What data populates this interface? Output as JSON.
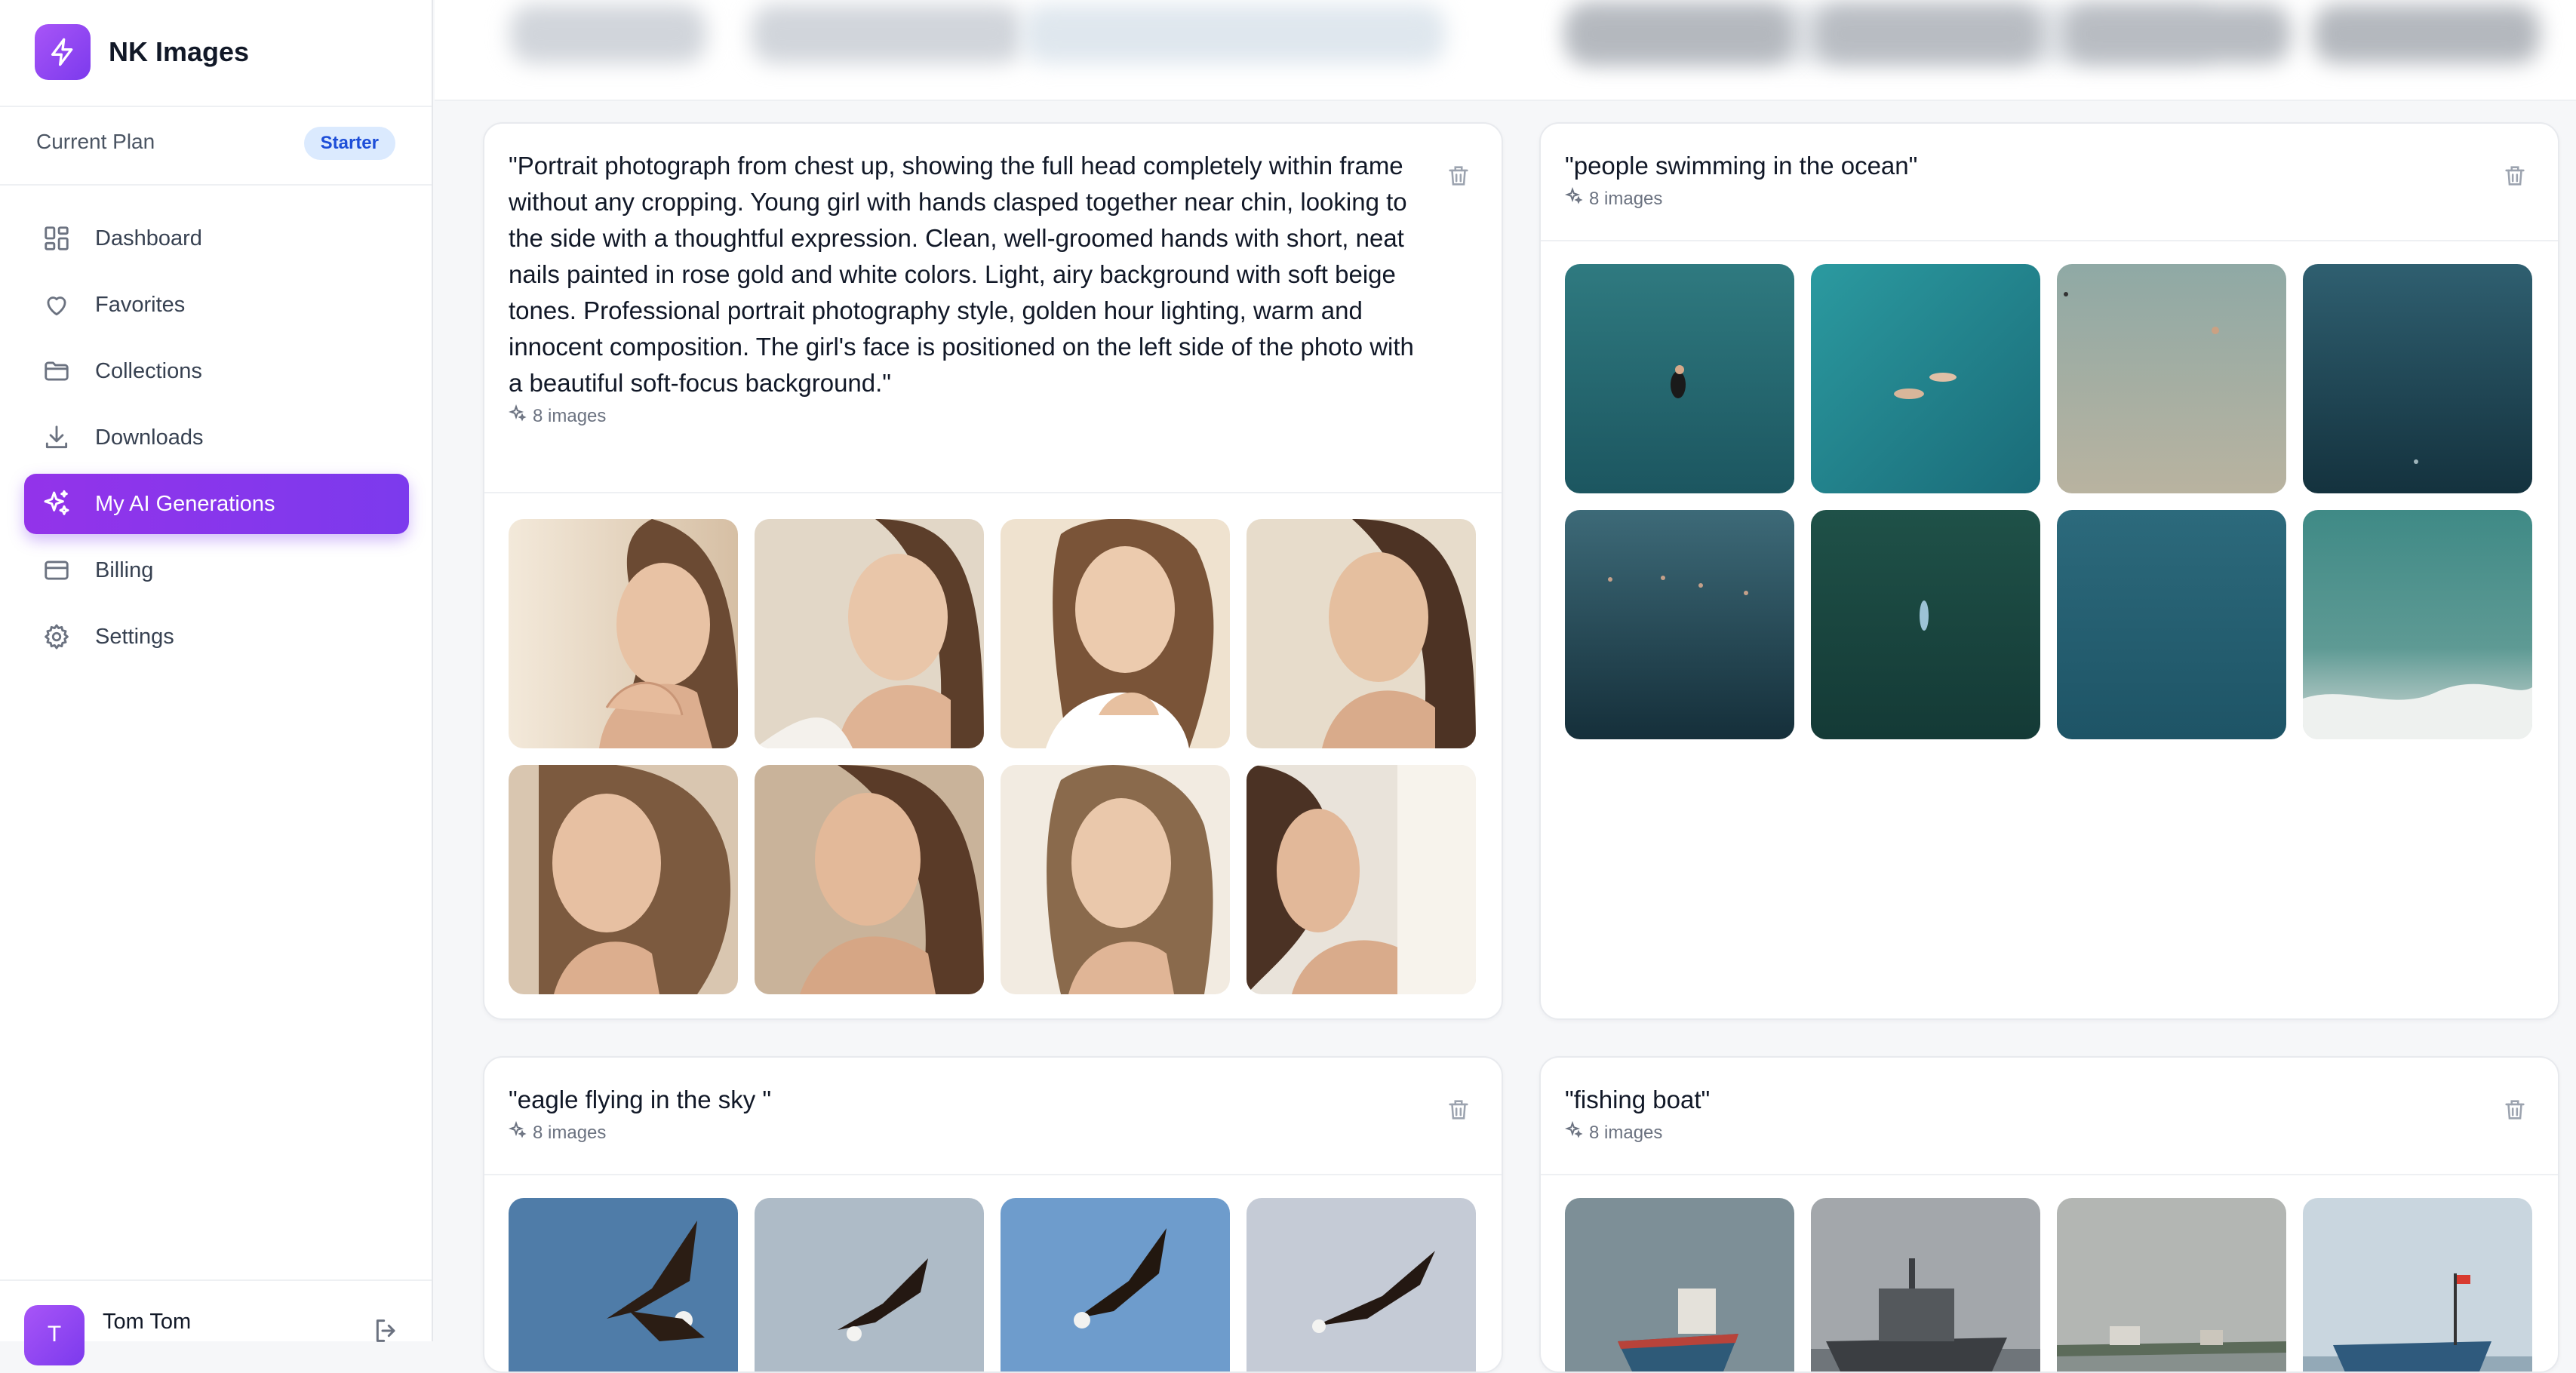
{
  "app": {
    "name": "NK Images"
  },
  "plan": {
    "label": "Current Plan",
    "badge": "Starter"
  },
  "nav": [
    {
      "id": "dashboard",
      "label": "Dashboard",
      "icon": "dashboard-icon",
      "active": false
    },
    {
      "id": "favorites",
      "label": "Favorites",
      "icon": "heart-icon",
      "active": false
    },
    {
      "id": "collections",
      "label": "Collections",
      "icon": "folder-icon",
      "active": false
    },
    {
      "id": "downloads",
      "label": "Downloads",
      "icon": "download-icon",
      "active": false
    },
    {
      "id": "ai-generations",
      "label": "My AI Generations",
      "icon": "sparkles-icon",
      "active": true
    },
    {
      "id": "billing",
      "label": "Billing",
      "icon": "credit-card-icon",
      "active": false
    },
    {
      "id": "settings",
      "label": "Settings",
      "icon": "gear-icon",
      "active": false
    }
  ],
  "user": {
    "initial": "T",
    "name": "Tom Tom"
  },
  "colors": {
    "accent": "#7c3aed",
    "badge_bg": "#dbeafe",
    "badge_text": "#1d4ed8"
  },
  "generations": [
    {
      "prompt": "\"Portrait photograph from chest up, showing the full head completely within frame without any cropping. Young girl with hands clasped together near chin, looking to the side with a thoughtful expression. Clean, well-groomed hands with short, neat nails painted in rose gold and white colors. Light, airy background with soft beige tones. Professional portrait photography style, golden hour lighting, warm and innocent composition. The girl's face is positioned on the left side of the photo with a beautiful soft-focus background.\"",
      "count": "8 images",
      "thumbs": [
        "portrait-1",
        "portrait-2",
        "portrait-3",
        "portrait-4",
        "portrait-5",
        "portrait-6",
        "portrait-7",
        "portrait-8"
      ]
    },
    {
      "prompt": "\"people swimming in the ocean\"",
      "count": "8 images",
      "thumbs": [
        "ocean-1",
        "ocean-2",
        "ocean-3",
        "ocean-4",
        "ocean-5",
        "ocean-6",
        "ocean-7",
        "ocean-8"
      ]
    },
    {
      "prompt": "\"eagle flying in the sky \"",
      "count": "8 images",
      "thumbs": [
        "eagle-1",
        "eagle-2",
        "eagle-3",
        "eagle-4"
      ]
    },
    {
      "prompt": "\"fishing boat\"",
      "count": "8 images",
      "thumbs": [
        "boat-1",
        "boat-2",
        "boat-3",
        "boat-4"
      ]
    }
  ]
}
